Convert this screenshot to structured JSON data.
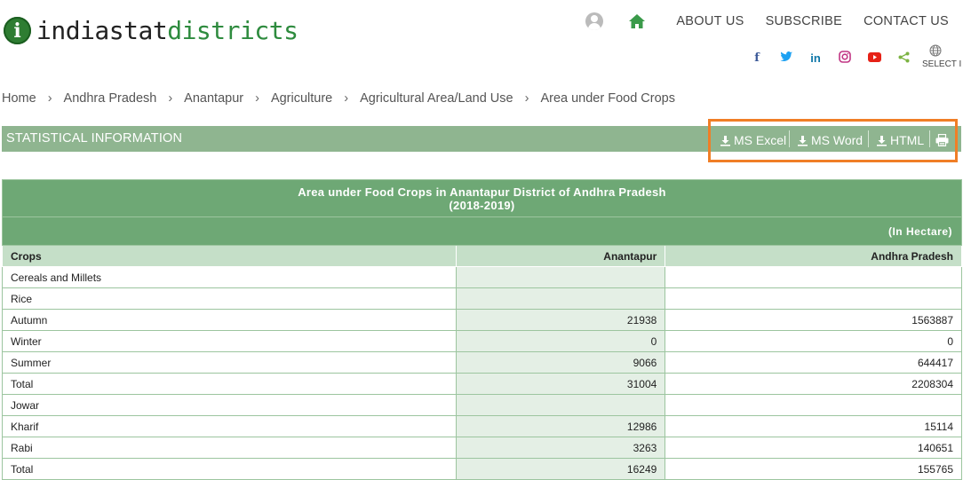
{
  "logo": {
    "part1": "indiastat",
    "part2": "districts"
  },
  "nav": {
    "about": "ABOUT US",
    "subscribe": "SUBSCRIBE",
    "contact": "CONTACT US"
  },
  "social_icons": [
    "facebook-icon",
    "twitter-icon",
    "linkedin-icon",
    "instagram-icon",
    "youtube-icon",
    "share-icon"
  ],
  "language": {
    "label": "SELECT I"
  },
  "breadcrumb": [
    "Home",
    "Andhra Pradesh",
    "Anantapur",
    "Agriculture",
    "Agricultural Area/Land Use",
    "Area under Food Crops"
  ],
  "section_title": "STATISTICAL INFORMATION",
  "downloads": {
    "excel": "MS Excel",
    "word": "MS Word",
    "html": "HTML"
  },
  "colors": {
    "brand_green": "#2e8b3e",
    "bar_green": "#8fb590",
    "table_header": "#6ea875",
    "highlight_orange": "#f07e26"
  },
  "table": {
    "title": "Area under Food Crops in Anantapur District of Andhra Pradesh",
    "subtitle": "(2018-2019)",
    "unit": "(In Hectare)",
    "columns": [
      "Crops",
      "Anantapur",
      "Andhra Pradesh"
    ],
    "rows": [
      [
        "Cereals and Millets",
        "",
        ""
      ],
      [
        "Rice",
        "",
        ""
      ],
      [
        "Autumn",
        "21938",
        "1563887"
      ],
      [
        "Winter",
        "0",
        "0"
      ],
      [
        "Summer",
        "9066",
        "644417"
      ],
      [
        "Total",
        "31004",
        "2208304"
      ],
      [
        "Jowar",
        "",
        ""
      ],
      [
        "Kharif",
        "12986",
        "15114"
      ],
      [
        "Rabi",
        "3263",
        "140651"
      ],
      [
        "Total",
        "16249",
        "155765"
      ]
    ]
  }
}
